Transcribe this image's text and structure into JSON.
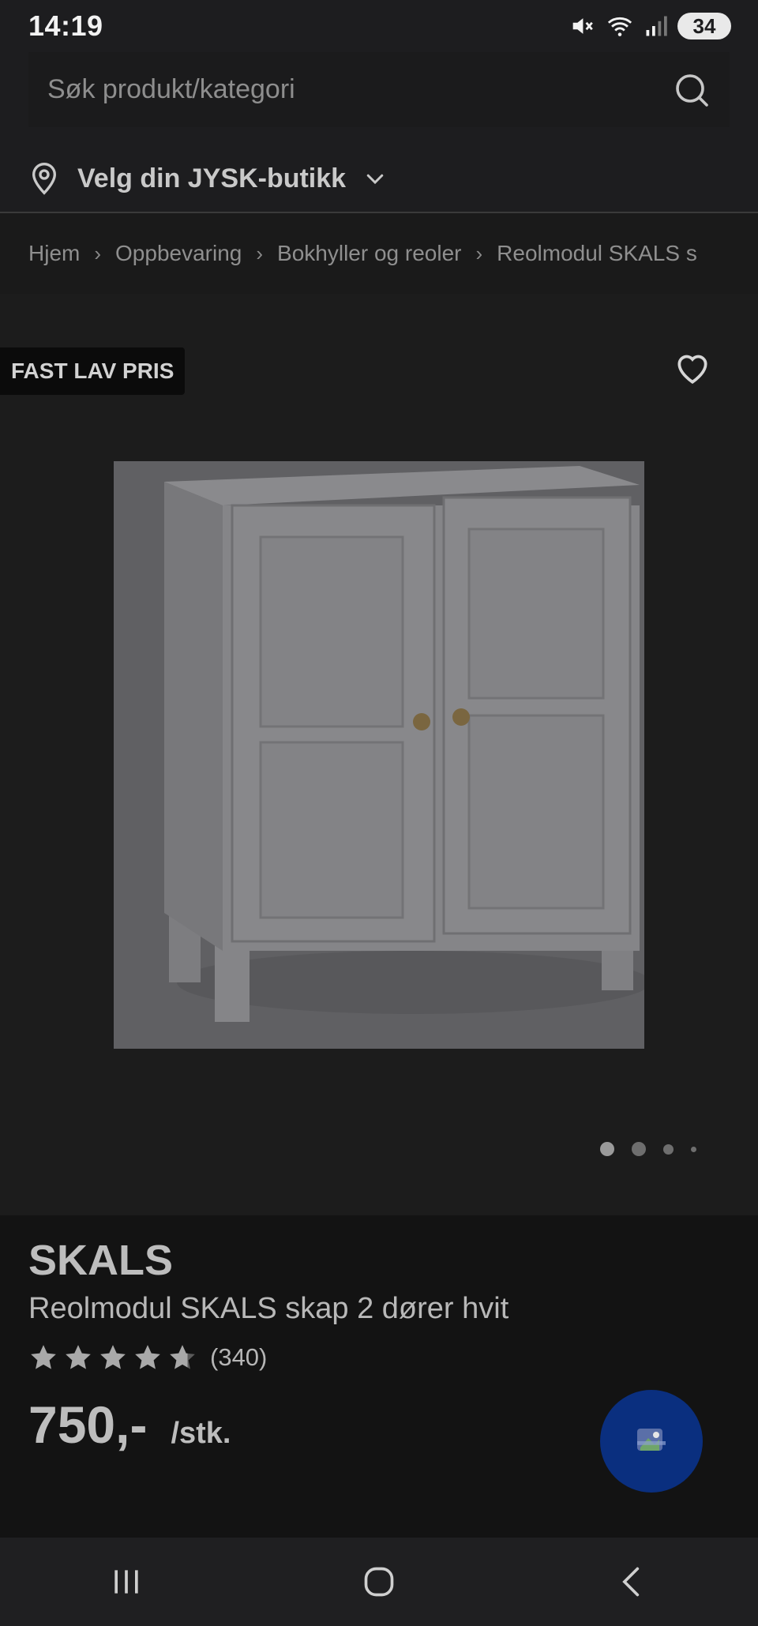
{
  "status_bar": {
    "time": "14:19",
    "battery": "34"
  },
  "search": {
    "placeholder": "Søk produkt/kategori"
  },
  "store": {
    "label": "Velg din JYSK-butikk"
  },
  "breadcrumb": [
    "Hjem",
    "Oppbevaring",
    "Bokhyller og reoler",
    "Reolmodul SKALS s"
  ],
  "badge": "FAST LAV PRIS",
  "gallery": {
    "image_count": 4,
    "active_index": 0
  },
  "product": {
    "brand": "SKALS",
    "name": "Reolmodul SKALS skap 2 dører hvit",
    "rating_stars": 5,
    "rating_count": "(340)",
    "price": "750,-",
    "unit": "/stk."
  },
  "colors": {
    "fab": "#0a2f7f",
    "background": "#141414"
  }
}
